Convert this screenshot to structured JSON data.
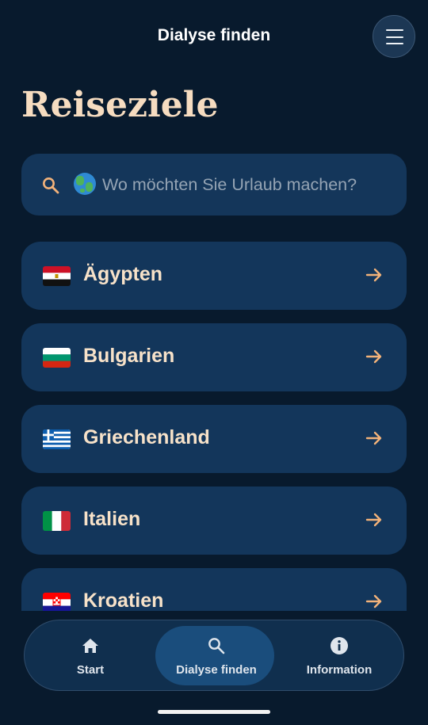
{
  "header": {
    "title": "Dialyse finden",
    "menu_icon": "hamburger-menu-icon"
  },
  "page": {
    "title": "Reiseziele"
  },
  "search": {
    "placeholder": "Wo möchten Sie Urlaub machen?",
    "value": "",
    "icon": "search-icon",
    "emoji": "globe-icon"
  },
  "destinations": [
    {
      "label": "Ägypten",
      "flag": "egypt-flag-icon"
    },
    {
      "label": "Bulgarien",
      "flag": "bulgaria-flag-icon"
    },
    {
      "label": "Griechenland",
      "flag": "greece-flag-icon"
    },
    {
      "label": "Italien",
      "flag": "italy-flag-icon"
    },
    {
      "label": "Kroatien",
      "flag": "croatia-flag-icon"
    }
  ],
  "bottom_nav": {
    "items": [
      {
        "label": "Start",
        "icon": "home-icon",
        "active": false
      },
      {
        "label": "Dialyse finden",
        "icon": "search-icon",
        "active": true
      },
      {
        "label": "Information",
        "icon": "info-icon",
        "active": false
      }
    ]
  },
  "colors": {
    "background": "#081a2d",
    "card": "#13365b",
    "accent": "#f2b27a",
    "title": "#f6dcc0"
  }
}
